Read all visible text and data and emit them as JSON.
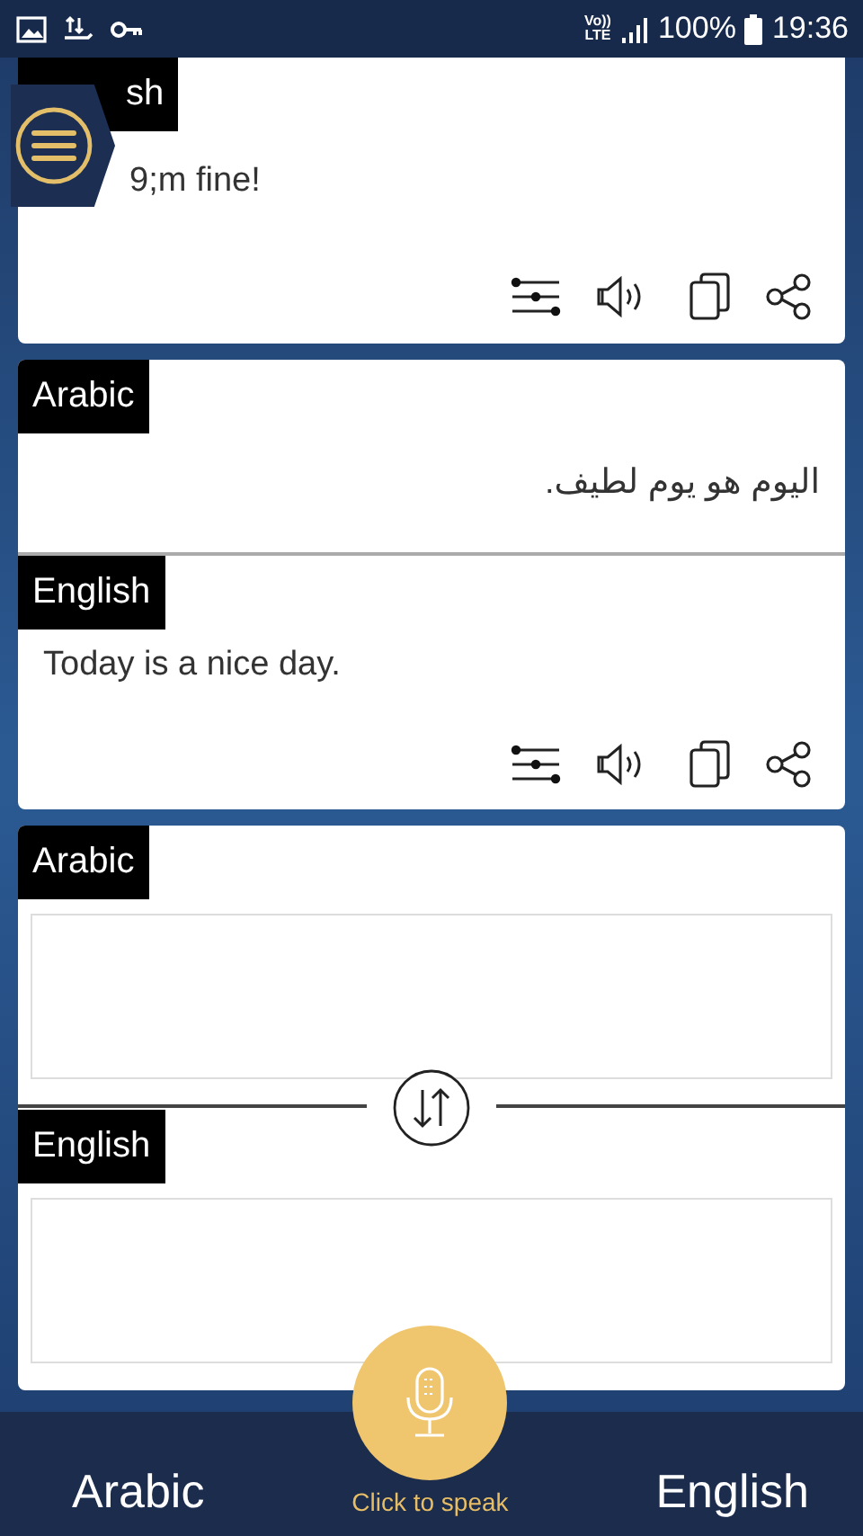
{
  "status_bar": {
    "volte_top": "Vo))",
    "volte_bottom": "LTE",
    "battery": "100%",
    "time": "19:36"
  },
  "cards": [
    {
      "kind": "partial_result",
      "sections": [
        {
          "label": "sh",
          "text": "9;m fine!"
        }
      ]
    },
    {
      "kind": "result",
      "sections": [
        {
          "label": "Arabic",
          "text": "اليوم هو يوم لطيف."
        },
        {
          "label": "English",
          "text": "Today is a nice day."
        }
      ]
    },
    {
      "kind": "input",
      "sections": [
        {
          "label": "Arabic"
        },
        {
          "label": "English"
        }
      ]
    }
  ],
  "bottom_bar": {
    "source_language": "Arabic",
    "target_language": "English",
    "mic_caption": "Click to speak"
  }
}
